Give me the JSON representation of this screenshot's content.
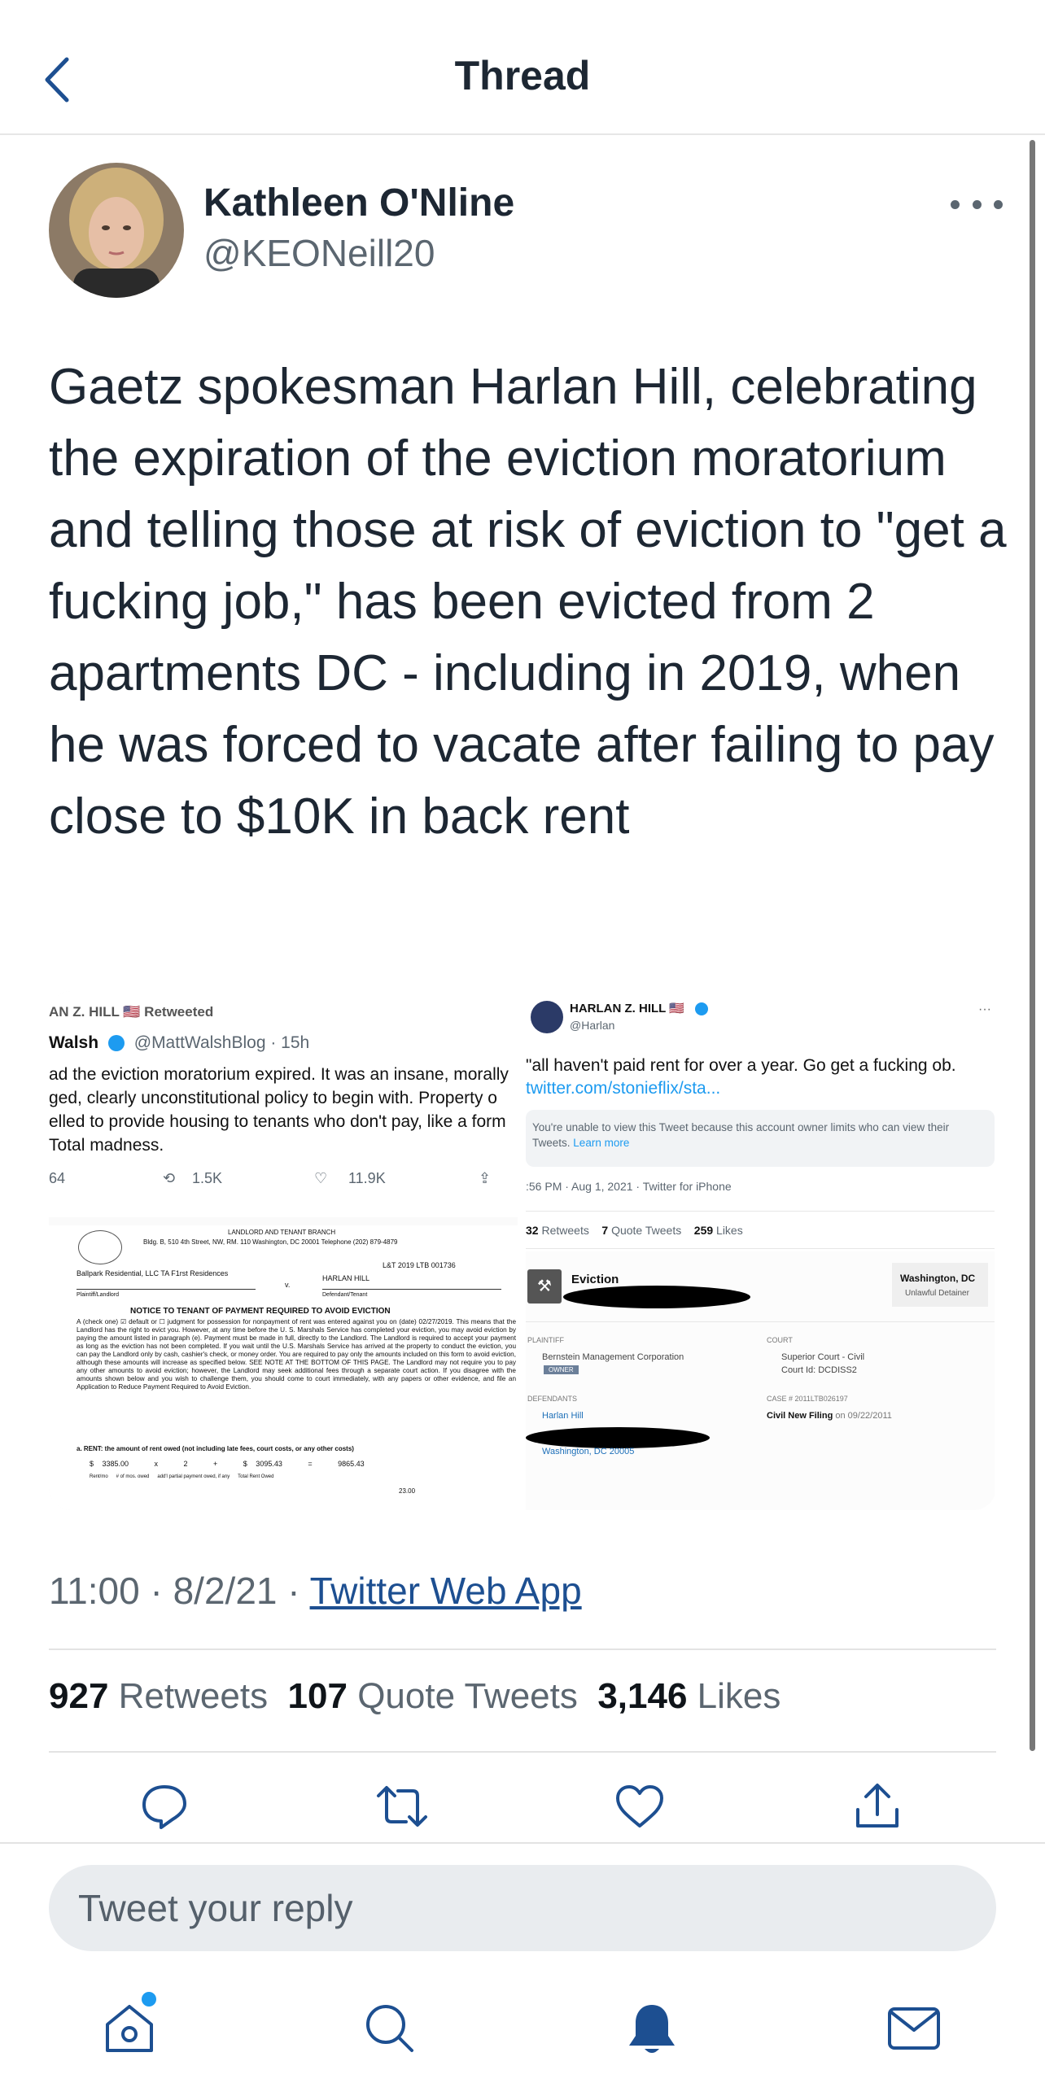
{
  "header": {
    "title": "Thread"
  },
  "tweet": {
    "author_name": "Kathleen O'Nline",
    "author_handle": "@KEONeill20",
    "text": "Gaetz spokesman Harlan Hill, celebrating the expiration of the eviction moratorium and telling those at risk of eviction to \"get a fucking job,\" has been evicted from 2 apartments DC - including in 2019, when he was forced to vacate after failing to pay close to $10K in back rent",
    "time": "11:00",
    "date": "8/2/21",
    "sep": "·",
    "source": "Twitter Web App",
    "retweets_count": "927",
    "retweets_label": "Retweets",
    "quotes_count": "107",
    "quotes_label": "Quote Tweets",
    "likes_count": "3,146",
    "likes_label": "Likes"
  },
  "media_left": {
    "retweeted_by": "AN Z. HILL 🇺🇸 Retweeted",
    "rt_name": "Walsh",
    "rt_handle": "@MattWalshBlog · 15h",
    "rt_text": "ad the eviction moratorium expired. It was an insane, morally ged, clearly unconstitutional policy to begin with. Property o elled to provide housing to tenants who don't pay, like a form Total madness.",
    "stat_replies": "64",
    "stat_retweets": "1.5K",
    "stat_likes": "11.9K",
    "doc_branch": "LANDLORD AND TENANT BRANCH",
    "doc_address": "Bldg. B, 510 4th Street, NW, RM. 110 Washington, DC 20001 Telephone (202) 879-4879",
    "doc_case": "L&T 2019 LTB 001736",
    "doc_plaintiff": "Ballpark Residential, LLC TA F1rst Residences",
    "doc_v": "v.",
    "doc_defendant": "HARLAN HILL",
    "doc_plaintiff_label": "Plaintiff/Landlord",
    "doc_defendant_label": "Defendant/Tenant",
    "doc_notice": "NOTICE TO TENANT OF PAYMENT REQUIRED TO AVOID EVICTION",
    "doc_body": "A (check one) ☑ default or ☐ judgment for possession for nonpayment of rent was entered against you on (date) 02/27/2019. This means that the Landlord has the right to evict you. However, at any time before the U. S. Marshals Service has completed your eviction, you may avoid eviction by paying the amount listed in paragraph (e). Payment must be made in full, directly to the Landlord. The Landlord is required to accept your payment as long as the eviction has not been completed. If you wait until the U.S. Marshals Service has arrived at the property to conduct the eviction, you can pay the Landlord only by cash, cashier's check, or money order. You are required to pay only the amounts included on this form to avoid eviction, although these amounts will increase as specified below. SEE NOTE AT THE BOTTOM OF THIS PAGE. The Landlord may not require you to pay any other amounts to avoid eviction; however, the Landlord may seek additional fees through a separate court action. If you disagree with the amounts shown below and you wish to challenge them, you should come to court immediately, with any papers or other evidence, and file an Application to Reduce Payment Required to Avoid Eviction.",
    "doc_rent_line": "a. RENT: the amount of rent owed (not including late fees, court costs, or any other costs)",
    "doc_amounts": "$ 3385.00   x   2   +   $ 3095.43   =   9865.43",
    "doc_amount_labels": "Rent/mo      # of mos. owed      add'l partial payment owed, if any      Total Rent Owed",
    "doc_extra": "23.00"
  },
  "media_right": {
    "name": "HARLAN Z. HILL 🇺🇸",
    "handle": "@Harlan",
    "text": "\"all haven't paid rent for over a year. Go get a fucking ob.",
    "link": "twitter.com/stonieflix/sta...",
    "notice": "You're unable to view this Tweet because this account owner limits who can view their Tweets.",
    "learn_more": "Learn more",
    "timestamp": ":56 PM · Aug 1, 2021 · Twitter for iPhone",
    "rt_count": "32",
    "rt_label": "Retweets",
    "qt_count": "7",
    "qt_label": "Quote Tweets",
    "likes_count": "259",
    "likes_label": "Likes",
    "eviction_title": "Eviction",
    "location": "Washington, DC",
    "location_sub": "Unlawful Detainer",
    "plaintiff_label": "PLAINTIFF",
    "plaintiff": "Bernstein Management Corporation",
    "owner_badge": "OWNER",
    "court_label": "COURT",
    "court": "Superior Court - Civil",
    "court_id": "Court Id: DCDISS2",
    "defendants_label": "DEFENDANTS",
    "defendant": "Harlan Hill",
    "defendant_city": "Washington, DC 20005",
    "case_label": "CASE # 2011LTB026197",
    "filing": "Civil New Filing",
    "filing_date": "on 09/22/2011"
  },
  "reply": {
    "placeholder": "Tweet your reply"
  },
  "icons": {
    "back": "chevron-left-icon",
    "more": "more-horizontal-icon",
    "reply": "reply-icon",
    "retweet": "retweet-icon",
    "like": "heart-icon",
    "share": "share-icon",
    "home": "home-icon",
    "search": "search-icon",
    "notifications": "bell-icon",
    "messages": "mail-icon"
  },
  "colors": {
    "accent": "#1d9bf0",
    "link": "#1d4f91",
    "text": "#0f1419",
    "muted": "#5b6670"
  }
}
